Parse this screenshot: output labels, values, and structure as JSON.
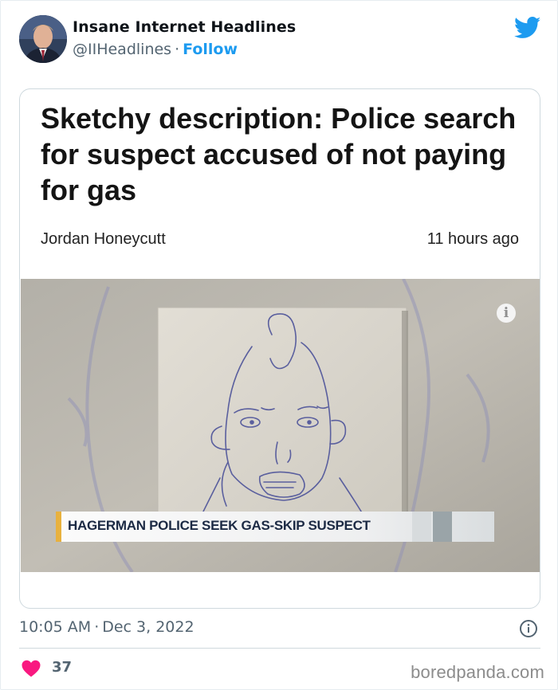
{
  "author": {
    "display_name": "Insane Internet Headlines",
    "handle": "@IIHeadlines",
    "separator": "·",
    "follow_label": "Follow"
  },
  "article": {
    "headline": "Sketchy description: Police search for suspect accused of not paying for gas",
    "byline": "Jordan Honeycutt",
    "time_ago": "11 hours ago",
    "info_glyph": "i",
    "lower_third": "HAGERMAN POLICE SEEK GAS-SKIP SUSPECT"
  },
  "footer": {
    "time": "10:05 AM",
    "separator": "·",
    "date": "Dec 3, 2022",
    "likes": "37"
  },
  "watermark": "boredpanda.com",
  "icons": {
    "brand": "twitter-bird-icon",
    "like": "heart-icon",
    "info": "info-circle-icon"
  },
  "colors": {
    "twitter_blue": "#1d9bf0",
    "like_red": "#f91880",
    "text_secondary": "#536471",
    "accent_gold": "#e8b13e",
    "banner_text": "#1c2a44"
  }
}
